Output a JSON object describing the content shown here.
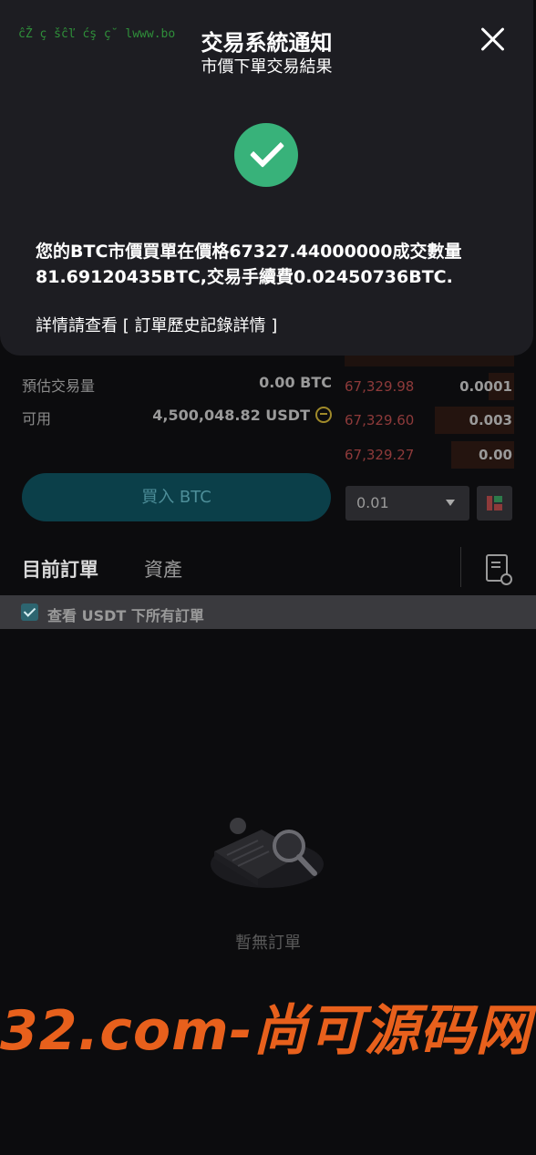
{
  "notification": {
    "ticker": "ĉŽ ç šĉľ ćş ç˘ lwww.bo",
    "title": "交易系統通知",
    "subtitle": "市價下單交易結果",
    "message_line1": "您的BTC市價買單在價格67327.44000000成交數量",
    "message_line2": "81.69120435BTC,交易手續費0.02450736BTC.",
    "detail_text": "詳情請查看",
    "detail_link": "[ 訂單歷史記錄詳情 ]"
  },
  "form": {
    "estimated_label": "預估交易量",
    "estimated_value": "0.00  BTC",
    "available_label": "可用",
    "available_value": "4,500,048.82  USDT",
    "buy_button": "買入 BTC",
    "quantity_value": "0.01"
  },
  "orderbook": [
    {
      "price": "67,329.98",
      "qty": "0.0001",
      "depth": 0.15
    },
    {
      "price": "67,329.60",
      "qty": "0.003",
      "depth": 0.47
    },
    {
      "price": "67,329.27",
      "qty": "0.00",
      "depth": 0.37
    }
  ],
  "tabs": {
    "current_orders": "目前訂單",
    "assets": "資產"
  },
  "filter": {
    "label": "查看 USDT 下所有訂單",
    "checked": true
  },
  "empty_state": {
    "text": "暫無訂單"
  },
  "watermark": {
    "text": "32.com-尚可源码网"
  },
  "colors": {
    "success": "#38b27a",
    "ask_price": "#8e3a3a",
    "buy_button": "#0b3f49",
    "watermark": "#e8601c"
  }
}
